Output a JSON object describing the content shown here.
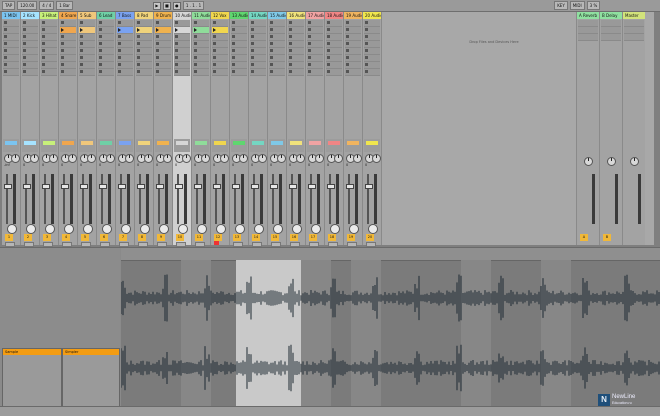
{
  "toolbar": {
    "tap_label": "TAP",
    "tempo": "120.00",
    "signature": "4 / 4",
    "quantize": "1 Bar",
    "position": "1 . 1 . 1",
    "key_label": "KEY",
    "midi_label": "MIDI",
    "cpu": "3 %"
  },
  "tracks": [
    {
      "name": "1 MIDI",
      "color": "#7bc4f0",
      "num": "1",
      "vol": "-inf"
    },
    {
      "name": "2 Kick",
      "color": "#a6e3ff",
      "num": "2",
      "vol": "0"
    },
    {
      "name": "3 Hihat",
      "color": "#c7f07a",
      "num": "3",
      "vol": "0"
    },
    {
      "name": "4 Snare",
      "color": "#f0a64e",
      "num": "4",
      "vol": "0"
    },
    {
      "name": "5 Sub",
      "color": "#f0c77b",
      "num": "5",
      "vol": "0"
    },
    {
      "name": "6 Lead",
      "color": "#6fd0a6",
      "num": "6",
      "vol": "0"
    },
    {
      "name": "7 Bass",
      "color": "#7aa2f0",
      "num": "7",
      "vol": "0"
    },
    {
      "name": "8 Pad",
      "color": "#f0d37b",
      "num": "8",
      "vol": "0"
    },
    {
      "name": "9 Drum",
      "color": "#f0b24e",
      "num": "9",
      "vol": "0"
    },
    {
      "name": "10 Audio",
      "color": "#d6d6d6",
      "num": "10",
      "vol": "0"
    },
    {
      "name": "11 Audio",
      "color": "#8fdc9a",
      "num": "11",
      "vol": "0"
    },
    {
      "name": "12 Vox",
      "color": "#f0d64e",
      "num": "12",
      "vol": "0"
    },
    {
      "name": "13 Audio",
      "color": "#5fd66f",
      "num": "13",
      "vol": "0"
    },
    {
      "name": "14 Audio",
      "color": "#74d6c2",
      "num": "14",
      "vol": "0"
    },
    {
      "name": "15 Audio",
      "color": "#7fc9e8",
      "num": "15",
      "vol": "0"
    },
    {
      "name": "16 Audio",
      "color": "#f0e27b",
      "num": "16",
      "vol": "0"
    },
    {
      "name": "17 Audio",
      "color": "#f0a3a3",
      "num": "17",
      "vol": "0"
    },
    {
      "name": "18 Audio",
      "color": "#f08585",
      "num": "18",
      "vol": "0"
    },
    {
      "name": "19 Audio",
      "color": "#f0b45f",
      "num": "19",
      "vol": "0"
    },
    {
      "name": "20 Audio",
      "color": "#f0e64e",
      "num": "20",
      "vol": "0"
    }
  ],
  "return_tracks": [
    {
      "name": "A Reverb",
      "color": "#8fe0a0",
      "num": "A"
    },
    {
      "name": "B Delay",
      "color": "#8fe0a0",
      "num": "B"
    }
  ],
  "master": {
    "name": "Master",
    "color": "#d2e37b"
  },
  "session": {
    "drop_hint": "Drop Files and Devices Here"
  },
  "clip_view": {
    "clip_name": "Sample",
    "device_name": "Simpler"
  },
  "brand": {
    "name": "NewLine",
    "sub": "Education.ru"
  }
}
